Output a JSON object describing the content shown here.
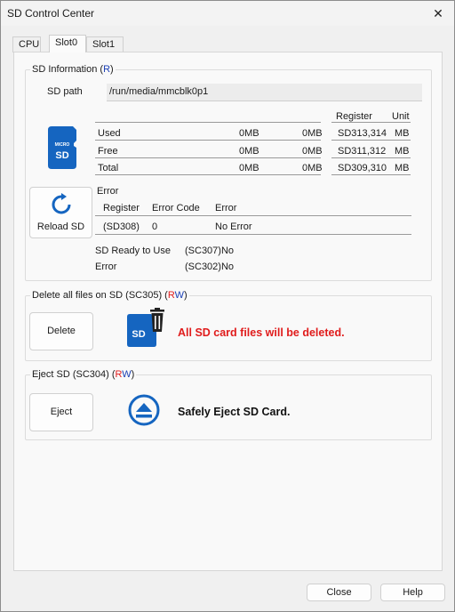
{
  "window": {
    "title": "SD Control Center",
    "close_glyph": "✕"
  },
  "tabs": [
    "CPU",
    "Slot0",
    "Slot1"
  ],
  "sd_info": {
    "legend_prefix": "SD Information (",
    "legend_access": "R",
    "legend_suffix": ")",
    "path_label": "SD path",
    "path_value": "/run/media/mmcblk0p1",
    "col_register": "Register",
    "col_unit": "Unit",
    "rows": [
      {
        "label": "Used",
        "v1": "0MB",
        "v2": "0MB",
        "register": "SD313,314",
        "unit": "MB"
      },
      {
        "label": "Free",
        "v1": "0MB",
        "v2": "0MB",
        "register": "SD311,312",
        "unit": "MB"
      },
      {
        "label": "Total",
        "v1": "0MB",
        "v2": "0MB",
        "register": "SD309,310",
        "unit": "MB"
      }
    ],
    "error_title": "Error",
    "err_headers": [
      "Register",
      "Error Code",
      "Error"
    ],
    "err_row": {
      "register": "(SD308)",
      "code": "0",
      "error": "No Error"
    },
    "ready_label": "SD Ready to Use",
    "ready_value": "(SC307)No",
    "error_label": "Error",
    "error_value": "(SC302)No",
    "reload_label": "Reload SD",
    "sd_icon_top": "MICRO",
    "sd_icon_main": "SD"
  },
  "delete_group": {
    "legend_prefix": "Delete all files on SD (SC305) (",
    "legend_r": "R",
    "legend_w": "W",
    "legend_suffix": ")",
    "button": "Delete",
    "icon_text": "SD",
    "warning": "All SD card files will be deleted."
  },
  "eject_group": {
    "legend_prefix": "Eject SD (SC304) (",
    "legend_r": "R",
    "legend_w": "W",
    "legend_suffix": ")",
    "button": "Eject",
    "message": "Safely Eject SD Card."
  },
  "footer": {
    "close": "Close",
    "help": "Help"
  },
  "colors": {
    "accent_blue": "#1565c0",
    "warn_red": "#e01c1c",
    "legend_blue": "#1a3fb4"
  }
}
